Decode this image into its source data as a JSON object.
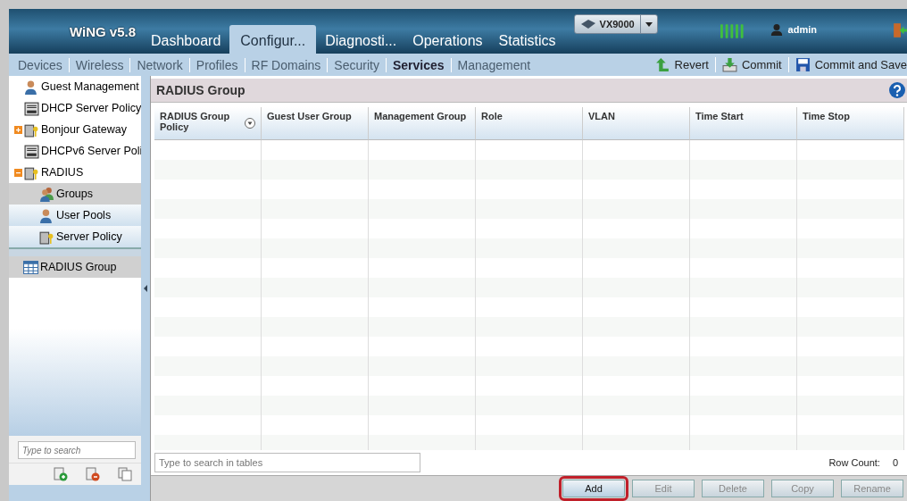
{
  "header": {
    "product": "WiNG v5.8",
    "device": "VX9000",
    "user": "admin"
  },
  "tabs": [
    {
      "label": "Dashboard",
      "selected": false
    },
    {
      "label": "Configur...",
      "selected": true
    },
    {
      "label": "Diagnosti...",
      "selected": false
    },
    {
      "label": "Operations",
      "selected": false
    },
    {
      "label": "Statistics",
      "selected": false
    }
  ],
  "subnav": [
    {
      "label": "Devices",
      "selected": false
    },
    {
      "label": "Wireless",
      "selected": false
    },
    {
      "label": "Network",
      "selected": false
    },
    {
      "label": "Profiles",
      "selected": false
    },
    {
      "label": "RF Domains",
      "selected": false
    },
    {
      "label": "Security",
      "selected": false
    },
    {
      "label": "Services",
      "selected": true
    },
    {
      "label": "Management",
      "selected": false
    }
  ],
  "actions": [
    {
      "label": "Revert",
      "kind": "revert"
    },
    {
      "label": "Commit",
      "kind": "commit"
    },
    {
      "label": "Commit and Save",
      "kind": "save"
    }
  ],
  "sidebar": {
    "items": [
      {
        "label": "Guest Management",
        "kind": "user",
        "selected": false
      },
      {
        "label": "DHCP Server Policy",
        "kind": "server",
        "selected": false
      },
      {
        "label": "Bonjour Gateway",
        "kind": "key",
        "expanded": false,
        "selected": false
      },
      {
        "label": "DHCPv6 Server Poli",
        "kind": "server",
        "selected": false
      },
      {
        "label": "RADIUS",
        "kind": "key",
        "expanded": true,
        "selected": false,
        "children": [
          {
            "label": "Groups",
            "kind": "group",
            "selected": true
          },
          {
            "label": "User Pools",
            "kind": "user",
            "selected": false
          },
          {
            "label": "Server Policy",
            "kind": "key",
            "selected": false
          }
        ]
      }
    ],
    "list": [
      {
        "label": "RADIUS Group",
        "selected": true
      }
    ],
    "search": {
      "placeholder": "Type to search"
    }
  },
  "panel": {
    "title": "RADIUS Group",
    "table": {
      "columns": [
        {
          "label": "RADIUS Group Policy",
          "sortable": true
        },
        {
          "label": "Guest User Group",
          "sortable": false
        },
        {
          "label": "Management Group",
          "sortable": false
        },
        {
          "label": "Role",
          "sortable": false
        },
        {
          "label": "VLAN",
          "sortable": false
        },
        {
          "label": "Time Start",
          "sortable": false
        },
        {
          "label": "Time Stop",
          "sortable": false
        }
      ]
    },
    "search": {
      "placeholder": "Type to search in tables"
    },
    "row_count_label": "Row Count:",
    "row_count": "0",
    "buttons": [
      {
        "label": "Add",
        "disabled": false,
        "highlighted": true
      },
      {
        "label": "Edit",
        "disabled": true,
        "highlighted": false
      },
      {
        "label": "Delete",
        "disabled": true,
        "highlighted": false
      },
      {
        "label": "Copy",
        "disabled": true,
        "highlighted": false
      },
      {
        "label": "Rename",
        "disabled": true,
        "highlighted": false
      }
    ]
  }
}
